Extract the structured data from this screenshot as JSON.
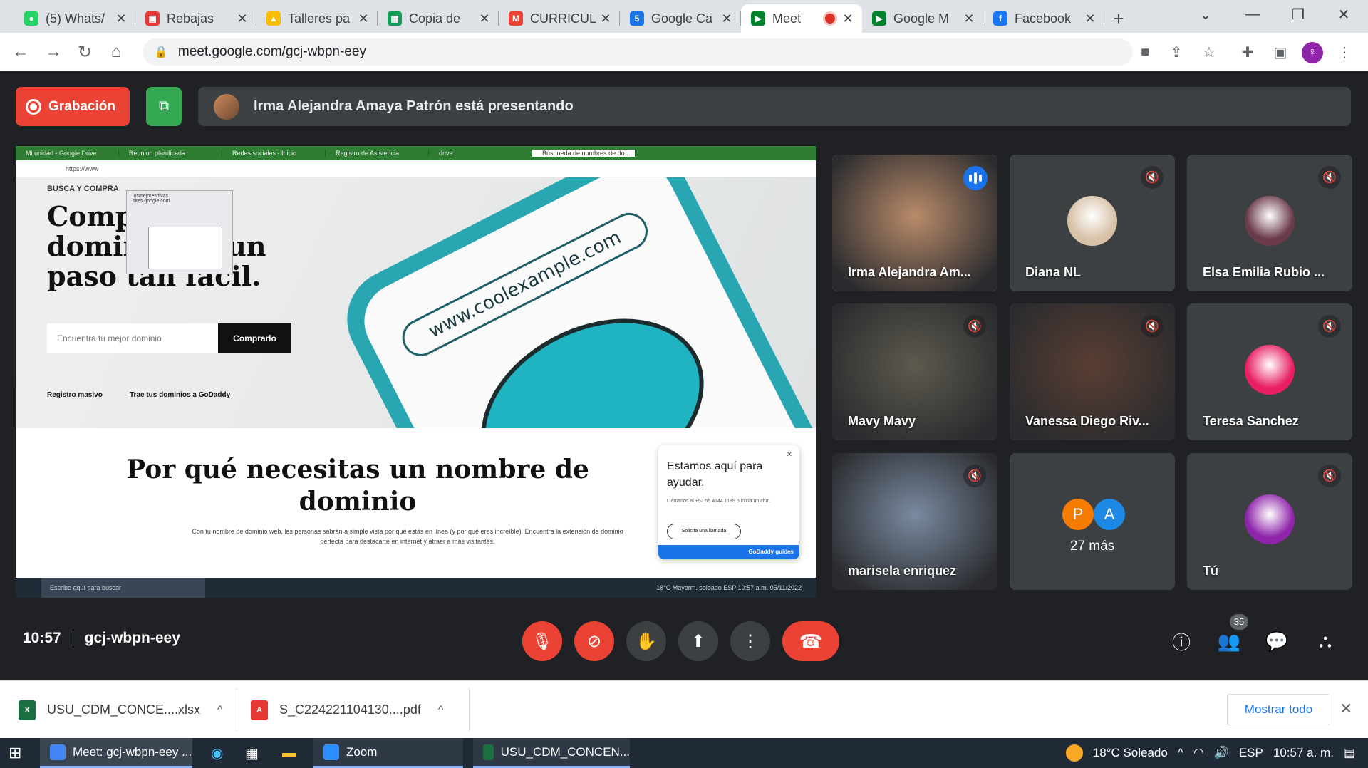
{
  "browser": {
    "tabs": [
      {
        "title": "(5) Whats/",
        "favicon": "whatsapp-icon",
        "color": "#25d366",
        "glyph": "●"
      },
      {
        "title": "Rebajas",
        "favicon": "brand-icon",
        "color": "#e53935",
        "glyph": "▣"
      },
      {
        "title": "Talleres pa",
        "favicon": "drive-icon",
        "color": "#fbbc04",
        "glyph": "▲"
      },
      {
        "title": "Copia de",
        "favicon": "sheets-icon",
        "color": "#0f9d58",
        "glyph": "▦"
      },
      {
        "title": "CURRICUL",
        "favicon": "gmail-icon",
        "color": "#ea4335",
        "glyph": "M"
      },
      {
        "title": "Google Ca",
        "favicon": "calendar-icon",
        "color": "#1a73e8",
        "glyph": "5"
      },
      {
        "title": "Meet",
        "favicon": "meet-icon",
        "color": "#00832d",
        "glyph": "▶",
        "active": true,
        "recording": true
      },
      {
        "title": "Google M",
        "favicon": "meet-icon",
        "color": "#00832d",
        "glyph": "▶"
      },
      {
        "title": "Facebook",
        "favicon": "facebook-icon",
        "color": "#1877f2",
        "glyph": "f"
      }
    ],
    "url": "meet.google.com/gcj-wbpn-eey",
    "profile_initial": "♀"
  },
  "meet": {
    "recording_label": "Grabación",
    "presenting_text": "Irma Alejandra Amaya Patrón está presentando",
    "time": "10:57",
    "meeting_code": "gcj-wbpn-eey",
    "people_count": "35"
  },
  "shared_screen": {
    "tabs": [
      "Mi unidad - Google Drive",
      "Reunion planificada",
      "Redes sociales - Inicio",
      "Registro de Asistencia",
      "drive",
      "Búsqueda de nombres de do..."
    ],
    "address": "https://www",
    "popup_line1": "lasmejoresdivas",
    "popup_line2": "sites.google.com",
    "section_label": "BUSCA Y COMPRA",
    "headline": "Compra tu dominio en un paso tan fácil.",
    "search_placeholder": "Encuentra tu mejor dominio",
    "search_button": "Comprarlo",
    "link1": "Registro masivo",
    "link2": "Trae tus dominios a GoDaddy",
    "phone_url": "www.coolexample.com",
    "why_heading": "Por qué necesitas un nombre de dominio",
    "why_text": "Con tu nombre de dominio web, las personas sabrán a simple vista por qué estás en línea (y por qué eres increíble). Encuentra la extensión de dominio perfecta para destacarte en internet y atraer a más visitantes.",
    "chat_title": "Estamos aquí para ayudar.",
    "chat_text": "Llámanos al +52 55 4744 1185 o inicia un chat.",
    "chat_button": "Solicita una llamada",
    "chat_footer": "GoDaddy guides",
    "taskbar_search": "Escribe aquí para buscar",
    "taskbar_tray": "18°C Mayorm. soleado  ESP  10:57 a.m.  05/11/2022"
  },
  "participants": [
    {
      "name": "Irma Alejandra Am...",
      "type": "video",
      "speaking": true,
      "bg": "#b98b6a"
    },
    {
      "name": "Diana NL",
      "type": "avatar",
      "muted": true,
      "bg": "#d7c2a8"
    },
    {
      "name": "Elsa Emilia Rubio ...",
      "type": "avatar",
      "muted": true,
      "bg": "#6b3b4a"
    },
    {
      "name": "Mavy Mavy",
      "type": "video",
      "muted": true,
      "bg": "#5d5a4e"
    },
    {
      "name": "Vanessa Diego Riv...",
      "type": "video",
      "muted": true,
      "bg": "#5a3e33"
    },
    {
      "name": "Teresa Sanchez",
      "type": "avatar",
      "muted": true,
      "bg": "#e91e63"
    },
    {
      "name": "marisela enriquez",
      "type": "video",
      "muted": true,
      "bg": "#7a8aa0"
    },
    {
      "name": "27 más",
      "type": "more",
      "initials": [
        "P",
        "A"
      ],
      "colors": [
        "#f57c00",
        "#1e88e5"
      ]
    },
    {
      "name": "Tú",
      "type": "avatar",
      "muted": true,
      "bg": "#8e24aa"
    }
  ],
  "downloads": [
    {
      "name": "USU_CDM_CONCE....xlsx",
      "icon": "excel-icon",
      "color": "#1d6f42",
      "glyph": "X"
    },
    {
      "name": "S_C224221104130....pdf",
      "icon": "pdf-icon",
      "color": "#e53935",
      "glyph": "A"
    }
  ],
  "shelf": {
    "show_all": "Mostrar todo"
  },
  "taskbar": {
    "apps": [
      {
        "label": "Meet: gcj-wbpn-eey ...",
        "icon": "chrome-icon",
        "color": "#4285f4"
      },
      {
        "label": "Zoom",
        "icon": "zoom-icon",
        "color": "#2d8cff"
      },
      {
        "label": "USU_CDM_CONCEN...",
        "icon": "excel-icon",
        "color": "#1d6f42"
      }
    ],
    "weather": "18°C  Soleado",
    "language": "ESP",
    "clock": "10:57 a. m."
  }
}
